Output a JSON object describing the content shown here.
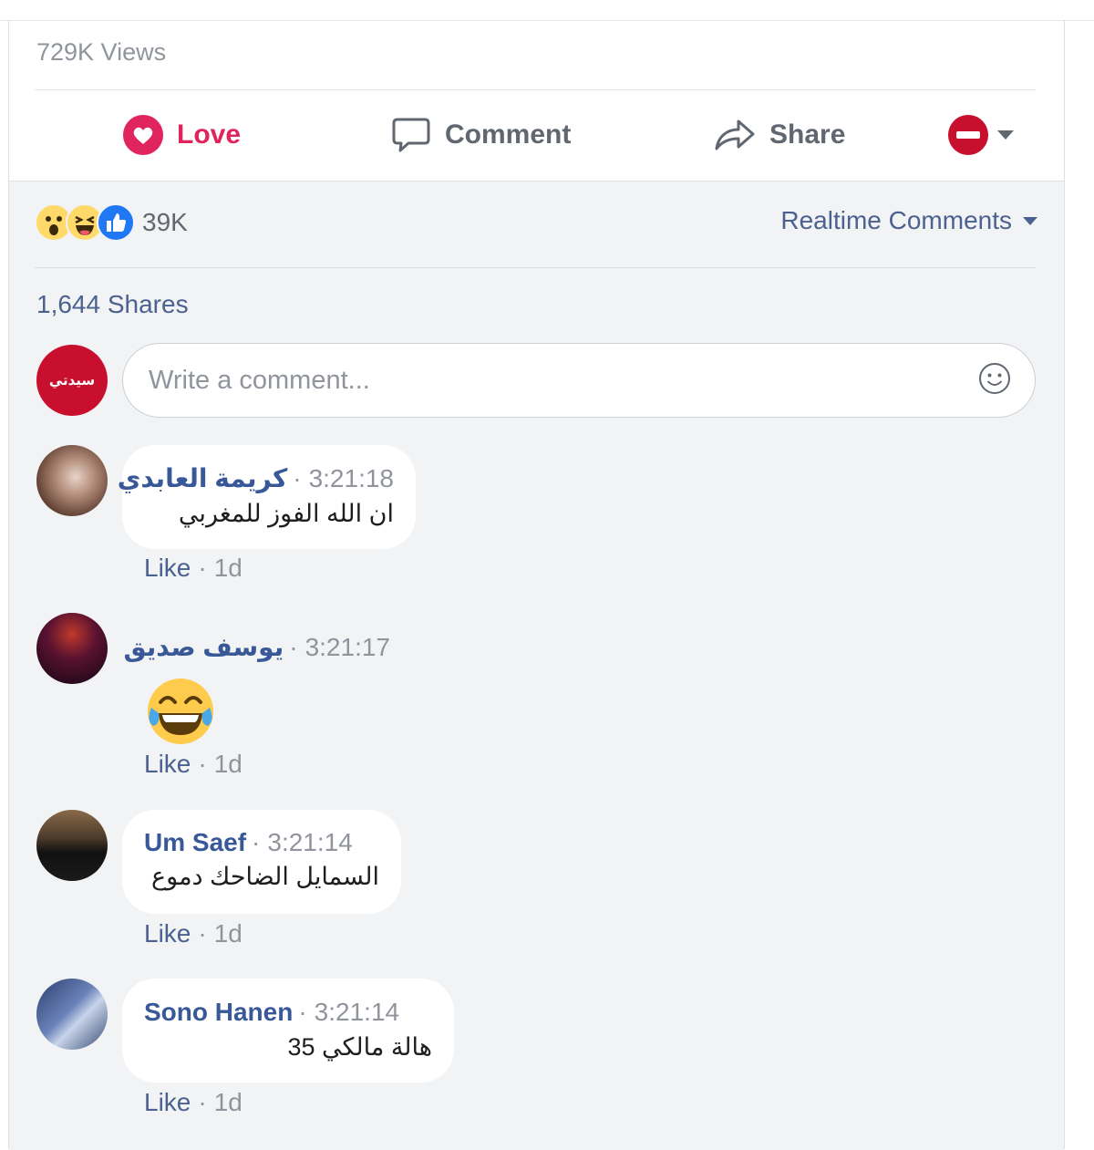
{
  "post": {
    "views": "729K Views",
    "actions": {
      "love_label": "Love",
      "comment_label": "Comment",
      "share_label": "Share"
    }
  },
  "reactions": {
    "icons": [
      "wow-reaction",
      "haha-reaction",
      "like-reaction"
    ],
    "count": "39K"
  },
  "comments_filter": {
    "label": "Realtime Comments"
  },
  "shares": "1,644 Shares",
  "page": {
    "avatar_text": "سيدتي"
  },
  "composer": {
    "placeholder": "Write a comment..."
  },
  "comments": [
    {
      "author": "كريمة العابدي",
      "timestamp": "3:21:18",
      "text": "ان الله الفوز للمغربي",
      "like_label": "Like",
      "age": "1d"
    },
    {
      "author": "يوسف صديق",
      "timestamp": "3:21:17",
      "text": "",
      "emoji": "tears-of-joy-emoji",
      "like_label": "Like",
      "age": "1d"
    },
    {
      "author": "Um Saef",
      "timestamp": "3:21:14",
      "text": "السمايل الضاحك دموع",
      "like_label": "Like",
      "age": "1d"
    },
    {
      "author": "Sono Hanen",
      "timestamp": "3:21:14",
      "text": "هالة مالكي 35",
      "like_label": "Like",
      "age": "1d"
    }
  ],
  "colors": {
    "love": "#e0245e",
    "link": "#4b6190",
    "author": "#385898",
    "muted": "#90949c",
    "panel_bg": "#f2f3f5",
    "brand": "#c8102e",
    "like_blue": "#2078f4"
  }
}
